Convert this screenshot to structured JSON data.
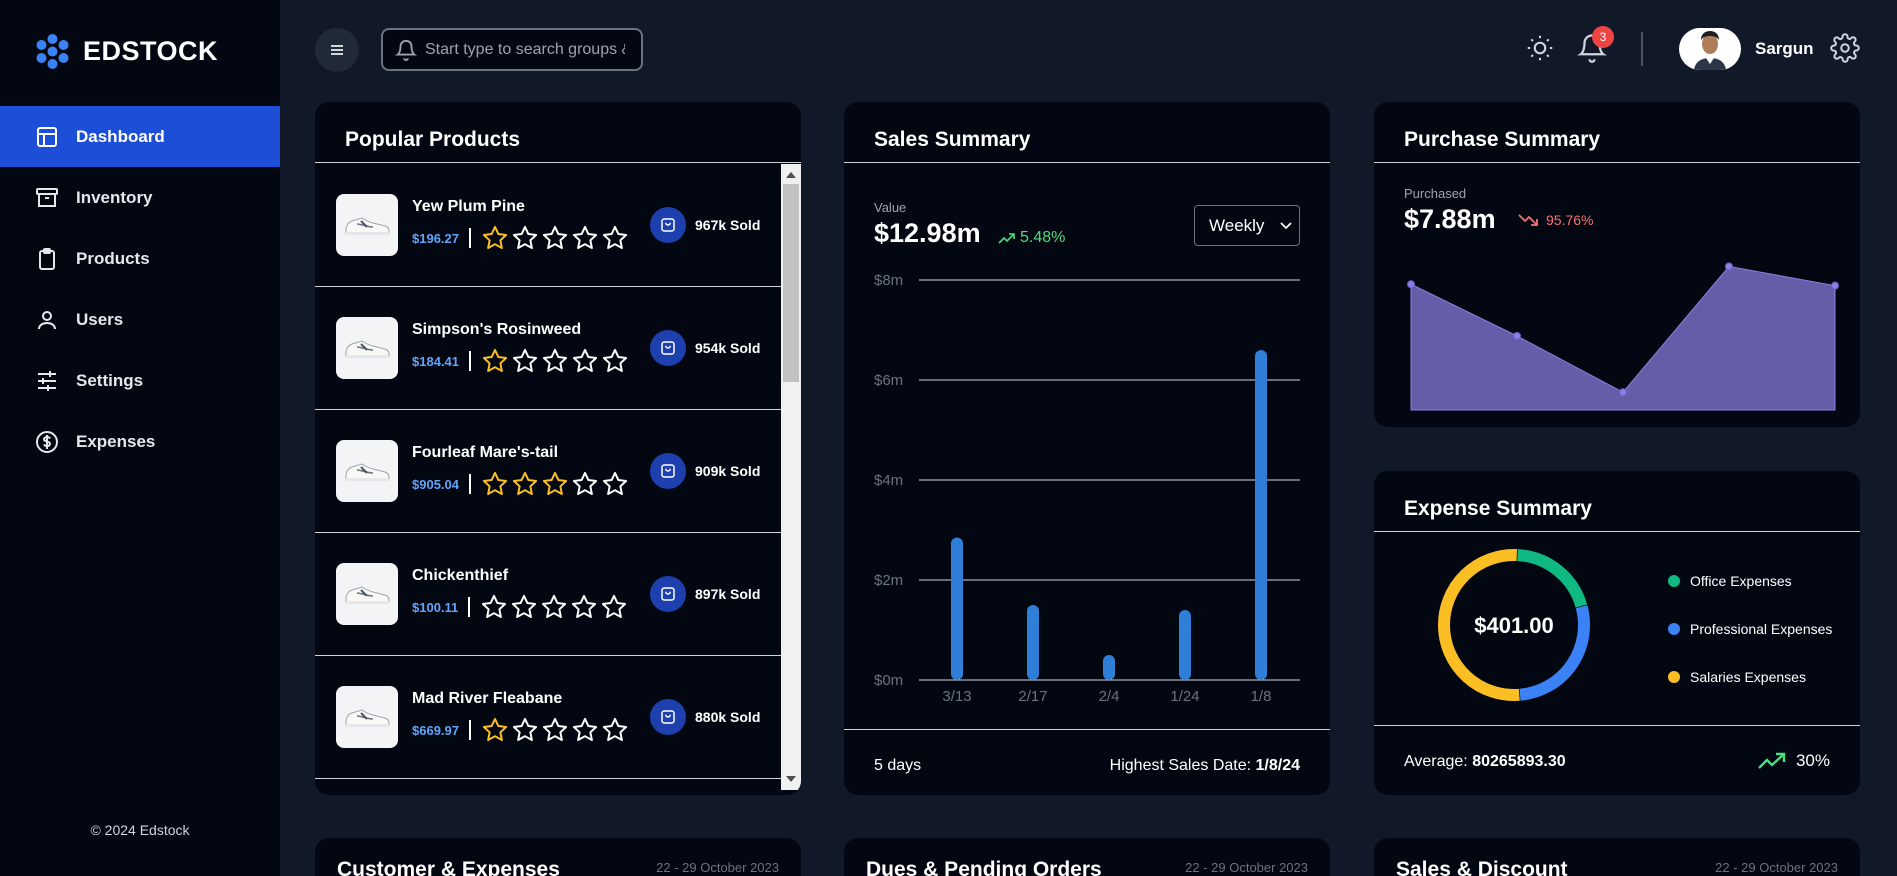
{
  "brand": {
    "name": "EDSTOCK",
    "copyright": "© 2024 Edstock"
  },
  "sidebar": {
    "items": [
      {
        "label": "Dashboard",
        "icon": "layout-icon",
        "active": true
      },
      {
        "label": "Inventory",
        "icon": "archive-icon"
      },
      {
        "label": "Products",
        "icon": "clipboard-icon"
      },
      {
        "label": "Users",
        "icon": "user-icon"
      },
      {
        "label": "Settings",
        "icon": "sliders-icon"
      },
      {
        "label": "Expenses",
        "icon": "dollar-circle-icon"
      }
    ]
  },
  "header": {
    "search_placeholder": "Start type to search groups & products",
    "notification_count": "3",
    "user_name": "Sargun"
  },
  "popular_products": {
    "title": "Popular Products",
    "items": [
      {
        "name": "Yew Plum Pine",
        "price": "$196.27",
        "rating": 1,
        "sold": "967k Sold"
      },
      {
        "name": "Simpson's Rosinweed",
        "price": "$184.41",
        "rating": 1,
        "sold": "954k Sold"
      },
      {
        "name": "Fourleaf Mare's-tail",
        "price": "$905.04",
        "rating": 3,
        "sold": "909k Sold"
      },
      {
        "name": "Chickenthief",
        "price": "$100.11",
        "rating": 0,
        "sold": "897k Sold"
      },
      {
        "name": "Mad River Fleabane",
        "price": "$669.97",
        "rating": 1,
        "sold": "880k Sold"
      }
    ]
  },
  "sales_summary": {
    "title": "Sales Summary",
    "value_label": "Value",
    "value": "$12.98m",
    "change": "5.48%",
    "period": "Weekly",
    "footer_days": "5 days",
    "highest_label": "Highest Sales Date:",
    "highest_date": "1/8/24"
  },
  "purchase_summary": {
    "title": "Purchase Summary",
    "label": "Purchased",
    "value": "$7.88m",
    "change": "95.76%"
  },
  "expense_summary": {
    "title": "Expense Summary",
    "total": "$401.00",
    "legend": [
      {
        "label": "Office Expenses",
        "color": "#10b981"
      },
      {
        "label": "Professional Expenses",
        "color": "#3b82f6"
      },
      {
        "label": "Salaries Expenses",
        "color": "#fbbf24"
      }
    ],
    "average_label": "Average:",
    "average_value": "80265893.30",
    "change": "30%"
  },
  "bottom_cards": [
    {
      "title": "Customer & Expenses",
      "date": "22 - 29 October 2023"
    },
    {
      "title": "Dues & Pending Orders",
      "date": "22 - 29 October 2023"
    },
    {
      "title": "Sales & Discount",
      "date": "22 - 29 October 2023"
    }
  ],
  "chart_data": [
    {
      "type": "bar",
      "categories": [
        "3/13",
        "2/17",
        "2/4",
        "1/24",
        "1/8"
      ],
      "values": [
        2.85,
        1.5,
        0.5,
        1.4,
        6.6
      ],
      "yticks": [
        "$0m",
        "$2m",
        "$4m",
        "$6m",
        "$8m"
      ],
      "ylim": [
        0,
        8
      ],
      "color": "#2f7ed8",
      "grid": true
    },
    {
      "type": "area",
      "values": [
        0.85,
        0.5,
        0.12,
        0.97,
        0.84
      ],
      "ylim": [
        0,
        1
      ],
      "color": "#8b7fe0"
    },
    {
      "type": "pie",
      "categories": [
        "Office Expenses",
        "Professional Expenses",
        "Salaries Expenses"
      ],
      "values": [
        20,
        28,
        52
      ],
      "colors": [
        "#10b981",
        "#3b82f6",
        "#fbbf24"
      ]
    }
  ]
}
